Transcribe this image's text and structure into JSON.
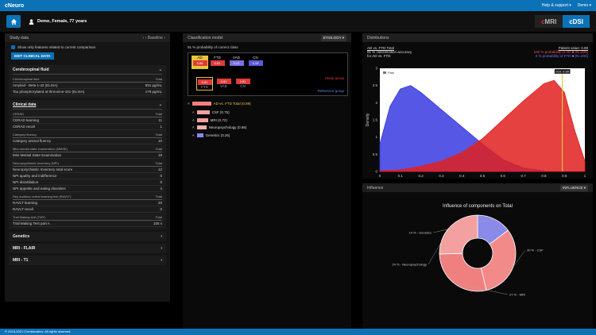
{
  "topbar": {
    "brand": "cNeuro",
    "help": "Help & support ▾",
    "user": "Demo ▾"
  },
  "patient": {
    "label": "Demo, Female, 77 years"
  },
  "modes": {
    "mri": "MRI",
    "dsi": "cDSI"
  },
  "study": {
    "title": "Study data",
    "baseline": "‹ › Baseline ›",
    "show_only": "Show only features related to current comparison",
    "edit_button": "EDIT CLINICAL DATA",
    "csf": {
      "title": "Cerebrospinal fluid",
      "group": "Cerebrospinal fluid",
      "total_label": "Total",
      "rows": [
        {
          "name": "Amyloid - Beta 1-42 (ELISA)",
          "value": "591 pg/mL"
        },
        {
          "name": "Tau phosphorylated at threonine-181 (ELISA)",
          "value": "179 pg/mL"
        }
      ]
    },
    "clinical": {
      "title": "Clinical data",
      "groups": [
        {
          "name": "CERAD",
          "total": "Total",
          "rows": [
            {
              "name": "CERAD learning",
              "value": "11"
            },
            {
              "name": "CERAD recall",
              "value": "1"
            }
          ]
        },
        {
          "name": "Category fluency",
          "total": "Total",
          "rows": [
            {
              "name": "Category animal fluency",
              "value": "10"
            }
          ]
        },
        {
          "name": "Mini-mental state examination (MMSE)",
          "total": "Total",
          "rows": [
            {
              "name": "Mini-Mental State Examination",
              "value": "19"
            }
          ]
        },
        {
          "name": "Neuropsychiatric Inventory (NPI)",
          "total": "Total",
          "rows": [
            {
              "name": "Neuropsychiatric Inventory total score",
              "value": "12"
            },
            {
              "name": "NPI apathy and indifference",
              "value": "0"
            },
            {
              "name": "NPI disinhibition",
              "value": "0"
            },
            {
              "name": "NPI appetite and eating disorders",
              "value": "4"
            }
          ]
        },
        {
          "name": "Rey auditory verbal learning test (RAVLT)",
          "total": "Total",
          "rows": [
            {
              "name": "RAVLT learning",
              "value": "20"
            },
            {
              "name": "RAVLT recall",
              "value": "0"
            }
          ]
        },
        {
          "name": "Trail Making test (TMT)",
          "total": "Total",
          "rows": [
            {
              "name": "Trail Making Test part A",
              "value": "105 s"
            }
          ]
        }
      ]
    },
    "collapsed": [
      "Genetics",
      "MRI - FLAIR",
      "MRI - T1"
    ]
  },
  "classification": {
    "title": "Classification model",
    "select": "ETIOLOGY ▾",
    "subtitle": "91 % probability of correct class",
    "classes": [
      {
        "label": "AD",
        "value": "0.88",
        "color": "#e8c53a"
      },
      {
        "label": "FTD",
        "value": "0.81",
        "color": "#e03a3a"
      },
      {
        "label": "VAD",
        "value": "0.12",
        "color": "#7b6fe0"
      },
      {
        "label": "CN",
        "value": "0.15",
        "color": "#5a5adb"
      }
    ],
    "study_group_label": "Study group",
    "reference_group_label": "Reference group",
    "ref_classes": [
      {
        "label": "FTD",
        "value": "0.81"
      },
      {
        "label": "VAD",
        "value": "0.81"
      },
      {
        "label": "CN",
        "value": "0.81"
      }
    ],
    "tree": [
      {
        "label": "AD vs. FTD Total (0.89)",
        "color": "#f08080",
        "w": 24
      },
      {
        "label": "CSF (0.75)",
        "color": "#f4a0a0",
        "w": 16
      },
      {
        "label": "MRI (0.72)",
        "color": "#f4a0a0",
        "w": 14
      },
      {
        "label": "Neuropsychology (0.66)",
        "color": "#f0b0b0",
        "w": 12
      },
      {
        "label": "Genetics (0.26)",
        "color": "#8888ee",
        "w": 8
      }
    ]
  },
  "distributions": {
    "title": "Distributions",
    "subtitle1": "AD vs. FTD Total",
    "subtitle2": "91 % classification accuracy",
    "subtitle3": "for AD vs. FTD",
    "patient_value": "Patient value: 0.89",
    "legend_ad": "100 % probability of AD ■ (N=200)",
    "legend_ftd": "0 % probability of FTD ■ (N=200)",
    "marker_label": "DSI: 0.89"
  },
  "influence": {
    "title": "Influence",
    "select": "INFLUENCE ▾",
    "chart_title": "Influence of components on Total"
  },
  "footer": {
    "text": "© 2016-2021 Combinostics. All rights reserved."
  },
  "chart_data": [
    {
      "type": "area",
      "title": "",
      "xlabel": "",
      "ylabel": "Density",
      "xlim": [
        0,
        1
      ],
      "ylim": [
        0,
        3
      ],
      "x_ticks": [
        "0",
        "0.1",
        "0.2",
        "0.3",
        "0.4",
        "0.5",
        "0.6",
        "0.7",
        "0.8",
        "0.9",
        "1"
      ],
      "y_ticks": [
        "0",
        "0.5",
        "1",
        "1.5",
        "2",
        "2.5",
        "3"
      ],
      "series": [
        {
          "color": "#3a3ae0",
          "x": [
            0.0,
            0.05,
            0.1,
            0.15,
            0.2,
            0.3,
            0.4,
            0.5,
            0.6,
            0.7,
            0.8
          ],
          "y": [
            0.8,
            1.9,
            2.4,
            2.5,
            2.3,
            1.8,
            1.3,
            0.8,
            0.35,
            0.1,
            0.02
          ]
        },
        {
          "color": "#e02020",
          "x": [
            0.0,
            0.1,
            0.2,
            0.3,
            0.4,
            0.5,
            0.6,
            0.7,
            0.8,
            0.85,
            0.9,
            0.95,
            1.0
          ],
          "y": [
            0.02,
            0.05,
            0.15,
            0.3,
            0.55,
            0.95,
            1.5,
            2.05,
            2.55,
            2.65,
            2.3,
            1.2,
            0.3
          ]
        }
      ],
      "legend_item": "Pats",
      "marker_x": 0.89
    },
    {
      "type": "pie",
      "title": "Influence of components on Total",
      "slices": [
        {
          "label": "14 % - Genetics",
          "value": 14,
          "color": "#8a8ae8"
        },
        {
          "label": "30 % - CSF",
          "value": 30,
          "color": "#f28a8a"
        },
        {
          "label": "27 % - MRI",
          "value": 27,
          "color": "#f08080"
        },
        {
          "label": "24 % - Neuropsychology",
          "value": 24,
          "color": "#f5a0a0"
        }
      ]
    }
  ]
}
